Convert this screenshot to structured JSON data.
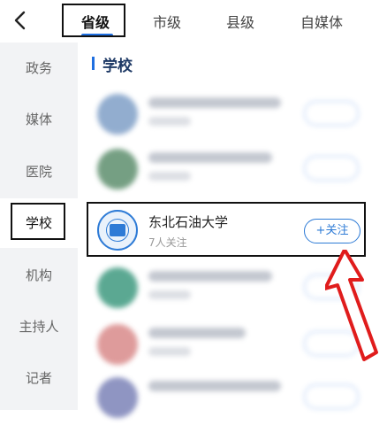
{
  "top_tabs": [
    "省级",
    "市级",
    "县级",
    "自媒体"
  ],
  "sidebar_items": [
    "政务",
    "媒体",
    "医院",
    "学校",
    "机构",
    "主持人",
    "记者"
  ],
  "section_title": "学校",
  "featured": {
    "name": "东北石油大学",
    "followers": "7人关注",
    "follow_label": "+关注"
  },
  "colors": {
    "accent": "#2e7bd6",
    "sidebar_bg": "#f2f3f5",
    "highlight_arrow": "#e01c1c"
  }
}
